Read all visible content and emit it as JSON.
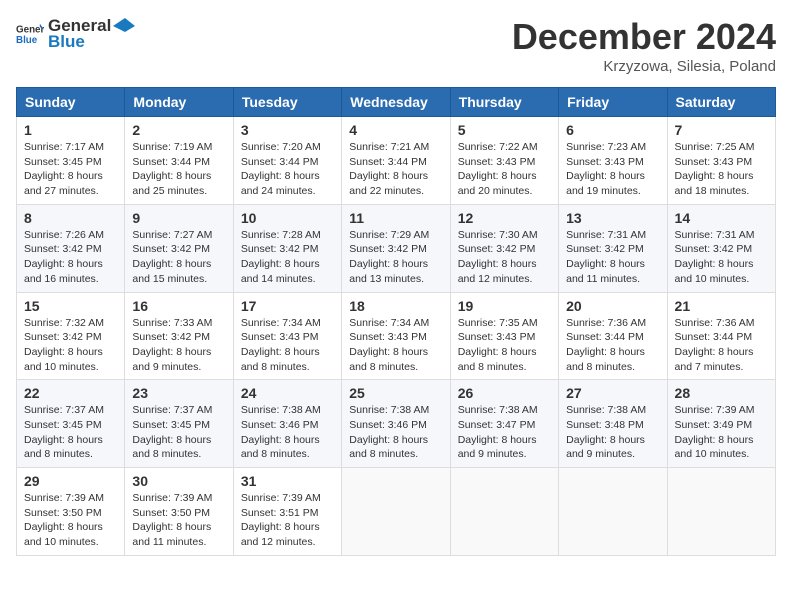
{
  "logo": {
    "general": "General",
    "blue": "Blue"
  },
  "header": {
    "month": "December 2024",
    "location": "Krzyzowa, Silesia, Poland"
  },
  "weekdays": [
    "Sunday",
    "Monday",
    "Tuesday",
    "Wednesday",
    "Thursday",
    "Friday",
    "Saturday"
  ],
  "weeks": [
    [
      {
        "day": "1",
        "sunrise": "7:17 AM",
        "sunset": "3:45 PM",
        "daylight": "8 hours and 27 minutes."
      },
      {
        "day": "2",
        "sunrise": "7:19 AM",
        "sunset": "3:44 PM",
        "daylight": "8 hours and 25 minutes."
      },
      {
        "day": "3",
        "sunrise": "7:20 AM",
        "sunset": "3:44 PM",
        "daylight": "8 hours and 24 minutes."
      },
      {
        "day": "4",
        "sunrise": "7:21 AM",
        "sunset": "3:44 PM",
        "daylight": "8 hours and 22 minutes."
      },
      {
        "day": "5",
        "sunrise": "7:22 AM",
        "sunset": "3:43 PM",
        "daylight": "8 hours and 20 minutes."
      },
      {
        "day": "6",
        "sunrise": "7:23 AM",
        "sunset": "3:43 PM",
        "daylight": "8 hours and 19 minutes."
      },
      {
        "day": "7",
        "sunrise": "7:25 AM",
        "sunset": "3:43 PM",
        "daylight": "8 hours and 18 minutes."
      }
    ],
    [
      {
        "day": "8",
        "sunrise": "7:26 AM",
        "sunset": "3:42 PM",
        "daylight": "8 hours and 16 minutes."
      },
      {
        "day": "9",
        "sunrise": "7:27 AM",
        "sunset": "3:42 PM",
        "daylight": "8 hours and 15 minutes."
      },
      {
        "day": "10",
        "sunrise": "7:28 AM",
        "sunset": "3:42 PM",
        "daylight": "8 hours and 14 minutes."
      },
      {
        "day": "11",
        "sunrise": "7:29 AM",
        "sunset": "3:42 PM",
        "daylight": "8 hours and 13 minutes."
      },
      {
        "day": "12",
        "sunrise": "7:30 AM",
        "sunset": "3:42 PM",
        "daylight": "8 hours and 12 minutes."
      },
      {
        "day": "13",
        "sunrise": "7:31 AM",
        "sunset": "3:42 PM",
        "daylight": "8 hours and 11 minutes."
      },
      {
        "day": "14",
        "sunrise": "7:31 AM",
        "sunset": "3:42 PM",
        "daylight": "8 hours and 10 minutes."
      }
    ],
    [
      {
        "day": "15",
        "sunrise": "7:32 AM",
        "sunset": "3:42 PM",
        "daylight": "8 hours and 10 minutes."
      },
      {
        "day": "16",
        "sunrise": "7:33 AM",
        "sunset": "3:42 PM",
        "daylight": "8 hours and 9 minutes."
      },
      {
        "day": "17",
        "sunrise": "7:34 AM",
        "sunset": "3:43 PM",
        "daylight": "8 hours and 8 minutes."
      },
      {
        "day": "18",
        "sunrise": "7:34 AM",
        "sunset": "3:43 PM",
        "daylight": "8 hours and 8 minutes."
      },
      {
        "day": "19",
        "sunrise": "7:35 AM",
        "sunset": "3:43 PM",
        "daylight": "8 hours and 8 minutes."
      },
      {
        "day": "20",
        "sunrise": "7:36 AM",
        "sunset": "3:44 PM",
        "daylight": "8 hours and 8 minutes."
      },
      {
        "day": "21",
        "sunrise": "7:36 AM",
        "sunset": "3:44 PM",
        "daylight": "8 hours and 7 minutes."
      }
    ],
    [
      {
        "day": "22",
        "sunrise": "7:37 AM",
        "sunset": "3:45 PM",
        "daylight": "8 hours and 8 minutes."
      },
      {
        "day": "23",
        "sunrise": "7:37 AM",
        "sunset": "3:45 PM",
        "daylight": "8 hours and 8 minutes."
      },
      {
        "day": "24",
        "sunrise": "7:38 AM",
        "sunset": "3:46 PM",
        "daylight": "8 hours and 8 minutes."
      },
      {
        "day": "25",
        "sunrise": "7:38 AM",
        "sunset": "3:46 PM",
        "daylight": "8 hours and 8 minutes."
      },
      {
        "day": "26",
        "sunrise": "7:38 AM",
        "sunset": "3:47 PM",
        "daylight": "8 hours and 9 minutes."
      },
      {
        "day": "27",
        "sunrise": "7:38 AM",
        "sunset": "3:48 PM",
        "daylight": "8 hours and 9 minutes."
      },
      {
        "day": "28",
        "sunrise": "7:39 AM",
        "sunset": "3:49 PM",
        "daylight": "8 hours and 10 minutes."
      }
    ],
    [
      {
        "day": "29",
        "sunrise": "7:39 AM",
        "sunset": "3:50 PM",
        "daylight": "8 hours and 10 minutes."
      },
      {
        "day": "30",
        "sunrise": "7:39 AM",
        "sunset": "3:50 PM",
        "daylight": "8 hours and 11 minutes."
      },
      {
        "day": "31",
        "sunrise": "7:39 AM",
        "sunset": "3:51 PM",
        "daylight": "8 hours and 12 minutes."
      },
      null,
      null,
      null,
      null
    ]
  ],
  "labels": {
    "sunrise": "Sunrise:",
    "sunset": "Sunset:",
    "daylight": "Daylight:"
  }
}
